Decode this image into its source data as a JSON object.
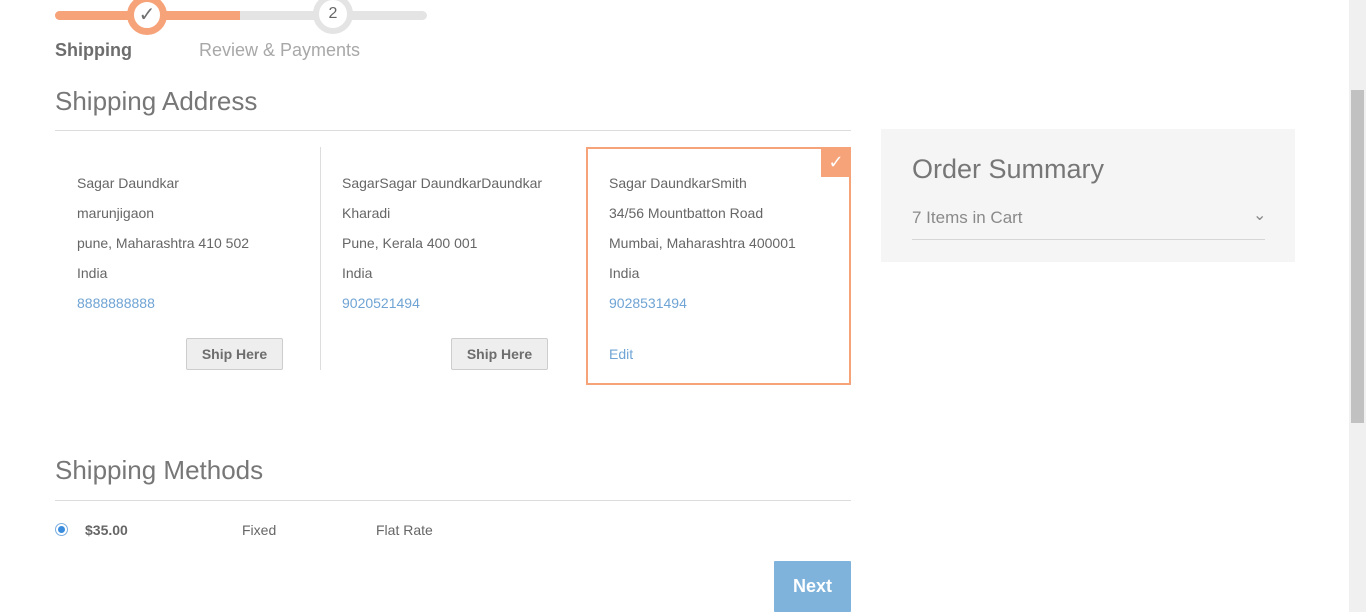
{
  "progress": {
    "steps": [
      {
        "label": "Shipping",
        "status": "complete",
        "icon": "check-icon"
      },
      {
        "label": "Review & Payments",
        "number": "2",
        "status": "pending"
      }
    ],
    "completion": 0.5
  },
  "shipping_address": {
    "title": "Shipping Address",
    "addresses": [
      {
        "name": "Sagar Daundkar",
        "street": "marunjigaon",
        "city_line": "pune, Maharashtra 410 502",
        "country": "India",
        "phone": "8888888888",
        "action": "Ship Here",
        "selected": false
      },
      {
        "name": "SagarSagar DaundkarDaundkar",
        "street": "Kharadi",
        "city_line": "Pune, Kerala 400 001",
        "country": "India",
        "phone": "9020521494",
        "action": "Ship Here",
        "selected": false
      },
      {
        "name": "Sagar DaundkarSmith",
        "street": "34/56 Mountbatton Road",
        "city_line": "Mumbai, Maharashtra 400001",
        "country": "India",
        "phone": "9028531494",
        "action": "Edit",
        "selected": true
      }
    ]
  },
  "order_summary": {
    "title": "Order Summary",
    "items_in_cart": "7 Items in Cart"
  },
  "shipping_methods": {
    "title": "Shipping Methods",
    "methods": [
      {
        "price": "$35.00",
        "type": "Fixed",
        "carrier": "Flat Rate",
        "selected": true
      }
    ]
  },
  "actions": {
    "next_label": "Next"
  },
  "colors": {
    "accent": "#f7a379",
    "link": "#6fa4d4",
    "primary_button": "#7fb3db"
  }
}
